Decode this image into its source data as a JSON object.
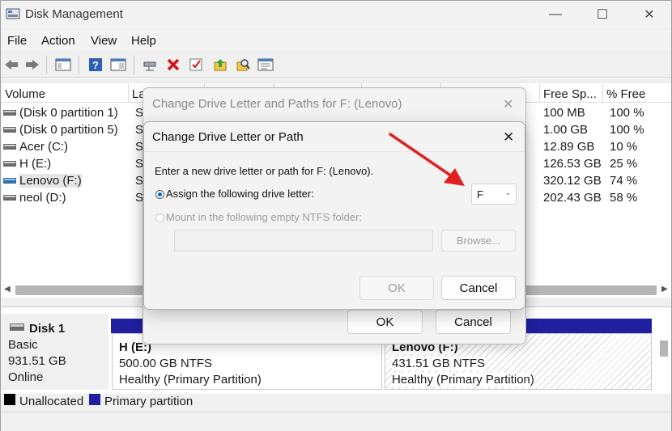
{
  "window": {
    "title": "Disk Management",
    "controls": {
      "minimize": "—",
      "maximize": "☐",
      "close": "✕"
    }
  },
  "menu": [
    "File",
    "Action",
    "View",
    "Help"
  ],
  "volume_list": {
    "headers": [
      "Volume",
      "La",
      "",
      "",
      "",
      "",
      "Free Sp...",
      "% Free"
    ],
    "rows": [
      {
        "volume": "(Disk 0 partition 1)",
        "layout": "Si",
        "free": "100 MB",
        "pct": "100 %"
      },
      {
        "volume": "(Disk 0 partition 5)",
        "layout": "Si",
        "free": "1.00 GB",
        "pct": "100 %"
      },
      {
        "volume": "Acer (C:)",
        "layout": "Si",
        "free": "12.89 GB",
        "pct": "10 %"
      },
      {
        "volume": "H (E:)",
        "layout": "Si",
        "free": "126.53 GB",
        "pct": "25 %"
      },
      {
        "volume": "Lenovo (F:)",
        "layout": "Si",
        "free": "320.12 GB",
        "pct": "74 %"
      },
      {
        "volume": "neol (D:)",
        "layout": "Si",
        "free": "202.43 GB",
        "pct": "58 %"
      }
    ]
  },
  "disk": {
    "name": "Disk 1",
    "type": "Basic",
    "size": "931.51 GB",
    "status": "Online",
    "partitions": [
      {
        "name": "H  (E:)",
        "size": "500.00 GB NTFS",
        "health": "Healthy (Primary Partition)"
      },
      {
        "name": "Lenovo  (F:)",
        "size": "431.51 GB NTFS",
        "health": "Healthy (Primary Partition)"
      }
    ]
  },
  "legend": {
    "unallocated": "Unallocated",
    "primary": "Primary partition",
    "colors": {
      "unallocated": "#000000",
      "primary": "#1f1f9f"
    }
  },
  "dialog_back": {
    "title": "Change Drive Letter and Paths for F: (Lenovo)",
    "ok": "OK",
    "cancel": "Cancel"
  },
  "dialog_front": {
    "title": "Change Drive Letter or Path",
    "prompt": "Enter a new drive letter or path for F: (Lenovo).",
    "option_assign": "Assign the following drive letter:",
    "option_mount": "Mount in the following empty NTFS folder:",
    "drive_letter": "F",
    "browse": "Browse...",
    "ok": "OK",
    "cancel": "Cancel"
  },
  "annotation": {
    "arrow_color": "#e02020"
  }
}
